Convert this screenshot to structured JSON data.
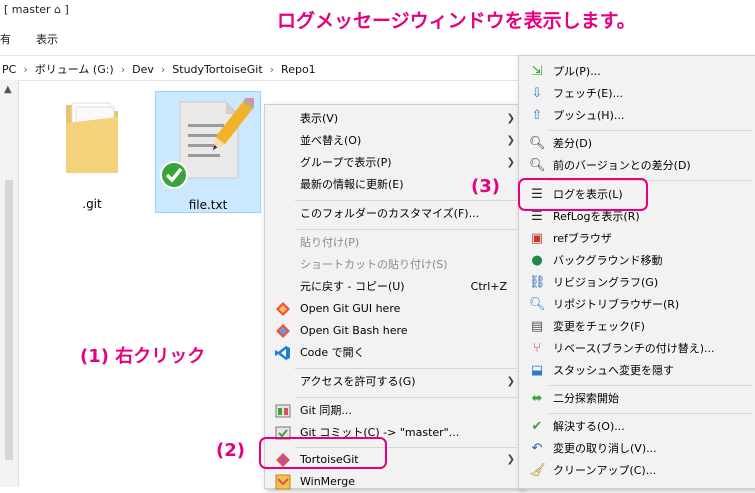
{
  "window": {
    "title": "[ master ⌂ ]"
  },
  "ribbon": {
    "item1": "有",
    "view": "表示"
  },
  "breadcrumb": [
    "PC",
    "ボリューム (G:)",
    "Dev",
    "StudyTortoiseGit",
    "Repo1"
  ],
  "files": [
    {
      "label": ".git",
      "icon": "folder-icon"
    },
    {
      "label": "file.txt",
      "icon": "text-file-icon",
      "overlay": "git-ok-overlay"
    }
  ],
  "annotations": {
    "banner": "ログメッセージウィンドウを表示します。",
    "step1": "(1) 右クリック",
    "step2": "(2)",
    "step3": "(3)"
  },
  "context_menu": {
    "items": [
      {
        "label": "表示(V)",
        "submenu": true
      },
      {
        "label": "並べ替え(O)",
        "submenu": true
      },
      {
        "label": "グループで表示(P)",
        "submenu": true
      },
      {
        "label": "最新の情報に更新(E)"
      },
      {
        "label": "このフォルダーのカスタマイズ(F)..."
      },
      {
        "label": "貼り付け(P)",
        "disabled": true
      },
      {
        "label": "ショートカットの貼り付け(S)",
        "disabled": true
      },
      {
        "label": "元に戻す - コピー(U)",
        "shortcut": "Ctrl+Z"
      },
      {
        "label": "Open Git GUI here",
        "icon": "git-diamond-icon"
      },
      {
        "label": "Open Git Bash here",
        "icon": "git-diamond-icon"
      },
      {
        "label": "Code で開く",
        "icon": "vscode-icon"
      },
      {
        "label": "アクセスを許可する(G)",
        "submenu": true
      },
      {
        "label": "Git 同期...",
        "icon": "git-sync-icon"
      },
      {
        "label": "Git コミット(C) -> \"master\"...",
        "icon": "git-commit-icon"
      },
      {
        "label": "TortoiseGit",
        "icon": "tortoisegit-icon",
        "submenu": true
      },
      {
        "label": "WinMerge",
        "icon": "winmerge-icon"
      }
    ]
  },
  "submenu": {
    "items": [
      {
        "label": "プル(P)...",
        "icon": "pull-icon"
      },
      {
        "label": "フェッチ(E)...",
        "icon": "fetch-icon"
      },
      {
        "label": "プッシュ(H)...",
        "icon": "push-icon"
      },
      {
        "label": "差分(D)",
        "icon": "diff-icon"
      },
      {
        "label": "前のバージョンとの差分(D)",
        "icon": "diff-prev-icon"
      },
      {
        "label": "ログを表示(L)",
        "icon": "log-icon"
      },
      {
        "label": "RefLogを表示(R)",
        "icon": "reflog-icon"
      },
      {
        "label": "refブラウザ",
        "icon": "ref-browser-icon"
      },
      {
        "label": "バックグラウンド移動",
        "icon": "globe-icon"
      },
      {
        "label": "リビジョングラフ(G)",
        "icon": "revision-graph-icon"
      },
      {
        "label": "リポジトリブラウザー(R)",
        "icon": "repo-browser-icon"
      },
      {
        "label": "変更をチェック(F)",
        "icon": "check-changes-icon"
      },
      {
        "label": "リベース(ブランチの付け替え)...",
        "icon": "rebase-icon"
      },
      {
        "label": "スタッシュへ変更を隠す",
        "icon": "stash-icon"
      },
      {
        "label": "二分探索開始",
        "icon": "bisect-icon"
      },
      {
        "label": "解決する(O)...",
        "icon": "resolve-icon"
      },
      {
        "label": "変更の取り消し(V)...",
        "icon": "revert-icon"
      },
      {
        "label": "クリーンアップ(C)...",
        "icon": "cleanup-icon"
      }
    ]
  },
  "colors": {
    "annotation": "#e6007e",
    "selection": "#cce8ff"
  }
}
